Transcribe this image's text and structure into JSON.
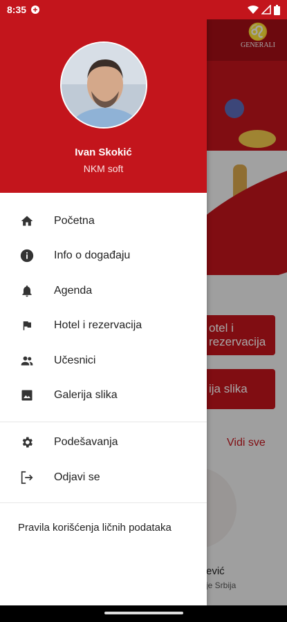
{
  "status_bar": {
    "time": "8:35"
  },
  "background": {
    "logo_text": "GENERALI",
    "button_hotel": "otel i rezervacija",
    "button_galerija": "ija slika",
    "see_all": "Vidi sve",
    "speaker_name": "ević",
    "speaker_org": "je Srbija"
  },
  "drawer": {
    "user": {
      "name": "Ivan Skokić",
      "company": "NKM soft"
    },
    "menu": [
      {
        "label": "Početna",
        "icon": "home-icon"
      },
      {
        "label": "Info o događaju",
        "icon": "info-icon"
      },
      {
        "label": "Agenda",
        "icon": "bell-icon"
      },
      {
        "label": "Hotel i rezervacija",
        "icon": "flag-icon"
      },
      {
        "label": "Učesnici",
        "icon": "people-icon"
      },
      {
        "label": "Galerija slika",
        "icon": "image-icon"
      }
    ],
    "settings": [
      {
        "label": "Podešavanja",
        "icon": "gear-icon"
      },
      {
        "label": "Odjavi se",
        "icon": "logout-icon"
      }
    ],
    "privacy_link": "Pravila korišćenja ličnih podataka"
  },
  "colors": {
    "brand_red": "#c3151c",
    "text": "#212121"
  }
}
